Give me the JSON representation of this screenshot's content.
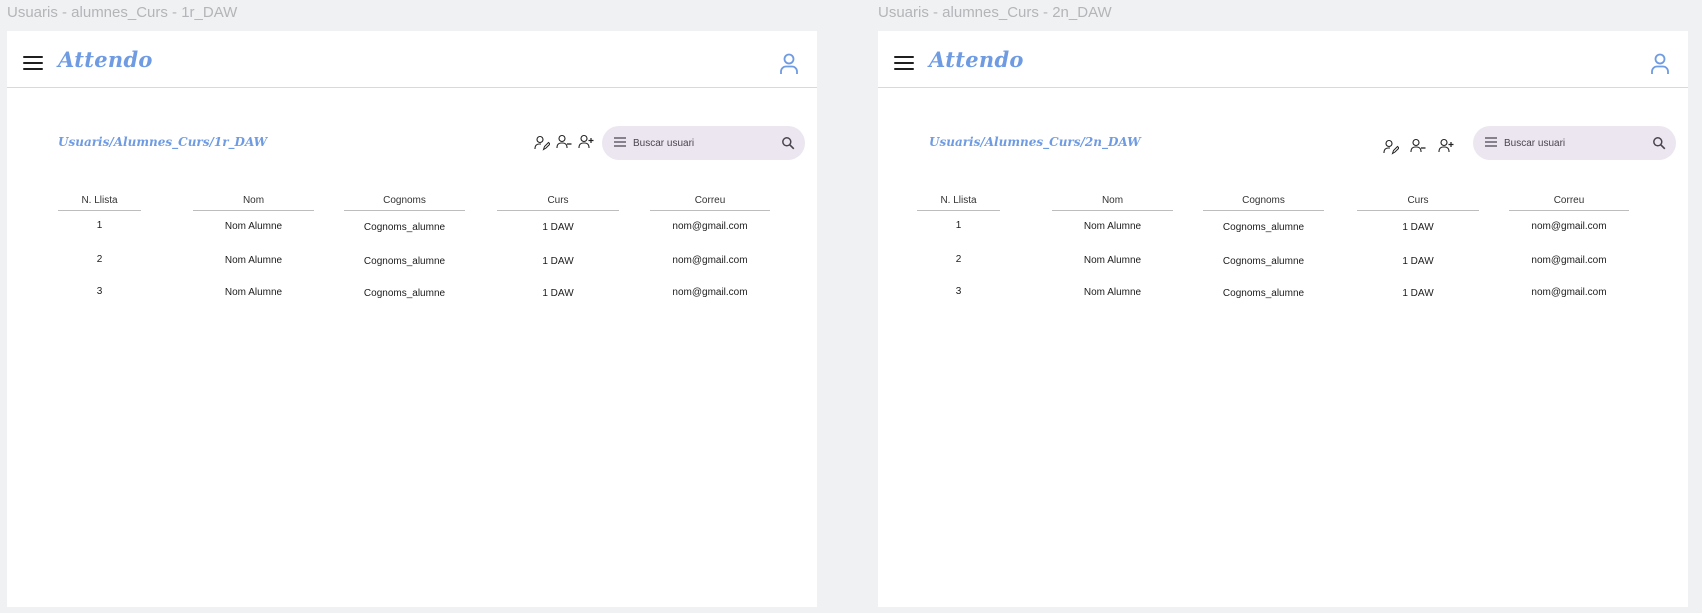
{
  "frames": [
    {
      "frame_label": "Usuaris - alumnes_Curs - 1r_DAW",
      "app_title": "Attendo",
      "breadcrumb": "Usuaris/Alumnes_Curs/1r_DAW",
      "search": {
        "placeholder": "Buscar usuari"
      },
      "table": {
        "columns": [
          "N. Llista",
          "Nom",
          "Cognoms",
          "Curs",
          "Correu"
        ],
        "rows": [
          [
            "1",
            "Nom Alumne",
            "Cognoms_alumne",
            "1 DAW",
            "nom@gmail.com"
          ],
          [
            "2",
            "Nom Alumne",
            "Cognoms_alumne",
            "1 DAW",
            "nom@gmail.com"
          ],
          [
            "3",
            "Nom Alumne",
            "Cognoms_alumne",
            "1 DAW",
            "nom@gmail.com"
          ]
        ]
      }
    },
    {
      "frame_label": "Usuaris - alumnes_Curs - 2n_DAW",
      "app_title": "Attendo",
      "breadcrumb": "Usuaris/Alumnes_Curs/2n_DAW",
      "search": {
        "placeholder": "Buscar usuari"
      },
      "table": {
        "columns": [
          "N. Llista",
          "Nom",
          "Cognoms",
          "Curs",
          "Correu"
        ],
        "rows": [
          [
            "1",
            "Nom Alumne",
            "Cognoms_alumne",
            "1 DAW",
            "nom@gmail.com"
          ],
          [
            "2",
            "Nom Alumne",
            "Cognoms_alumne",
            "1 DAW",
            "nom@gmail.com"
          ],
          [
            "3",
            "Nom Alumne",
            "Cognoms_alumne",
            "1 DAW",
            "nom@gmail.com"
          ]
        ]
      }
    }
  ],
  "icons": {
    "menu": "hamburger-menu-icon",
    "account": "user-account-icon",
    "edit_user": "user-edit-icon",
    "remove_user": "user-remove-icon",
    "add_user": "user-add-icon",
    "search": "search-icon"
  },
  "colors": {
    "brand": "#6f9be3",
    "search_bg": "#ece6f0",
    "canvas_bg": "#f0f1f3"
  }
}
